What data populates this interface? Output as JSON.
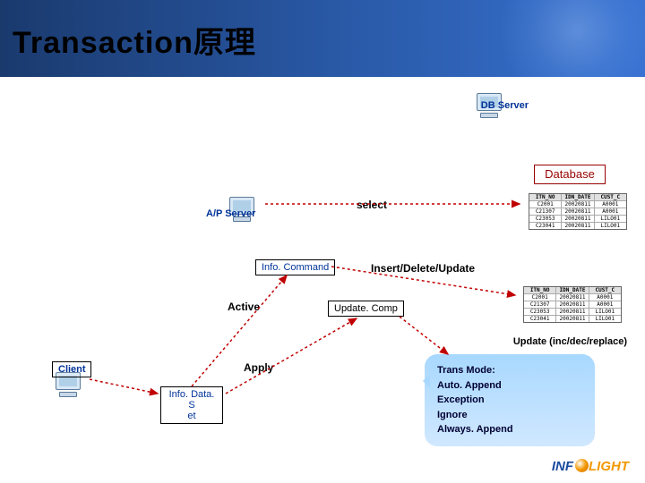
{
  "title": "Transaction原理",
  "nodes": {
    "db_server": "DB Server",
    "ap_server": "A/P Server",
    "client": "Client",
    "database": "Database"
  },
  "labels": {
    "select": "select",
    "info_command": "Info. Command",
    "insert_delete_update": "Insert/Delete/Update",
    "active": "Active",
    "update_comp": "Update. Comp",
    "apply": "Apply",
    "info_dataset_1": "Info. Data. S",
    "info_dataset_2": "et",
    "update_modes": "Update (inc/dec/replace)"
  },
  "trans_mode": {
    "heading": "Trans Mode:",
    "items": [
      "Auto. Append",
      "Exception",
      "Ignore",
      "Always. Append"
    ]
  },
  "table": {
    "headers": [
      "ITN_NO",
      "IDN_DATE",
      "CUST_C"
    ],
    "rows": [
      [
        "C2001",
        "20020811",
        "A0001"
      ],
      [
        "C21307",
        "20020811",
        "A0001"
      ],
      [
        "C23053",
        "20020811",
        "LILO01"
      ],
      [
        "C23041",
        "20020811",
        "LILO01"
      ]
    ]
  },
  "logo": {
    "part1": "INF",
    "part2": "LIGHT"
  }
}
